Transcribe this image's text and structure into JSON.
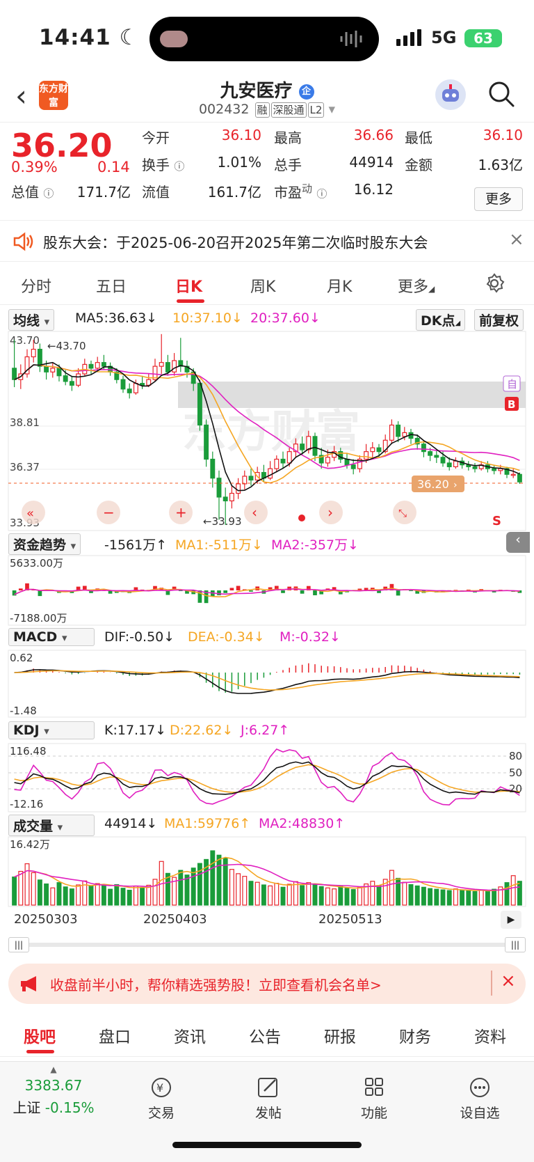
{
  "status_bar": {
    "time": "14:41",
    "network": "5G",
    "battery": "63"
  },
  "header": {
    "logo_text": "东方财富",
    "stock_name": "九安医疗",
    "corp_badge": "企",
    "stock_code": "002432",
    "tags": [
      "融",
      "深股通",
      "L2"
    ]
  },
  "quote": {
    "price": "36.20",
    "change_pct": "0.39%",
    "change": "0.14",
    "open_label": "今开",
    "open": "36.10",
    "high_label": "最高",
    "high": "36.66",
    "low_label": "最低",
    "low": "36.10",
    "turnover_label": "换手",
    "turnover": "1.01%",
    "volume_label": "总手",
    "volume": "44914",
    "amount_label": "金额",
    "amount": "1.63亿",
    "mcap_label": "总值",
    "mcap": "171.7亿",
    "float_label": "流值",
    "float": "161.7亿",
    "pe_label": "市盈",
    "pe_sup": "动",
    "pe": "16.12",
    "more_label": "更多"
  },
  "notice": {
    "text": "股东大会：于2025-06-20召开2025年第二次临时股东大会"
  },
  "tabs": [
    "分时",
    "五日",
    "日K",
    "周K",
    "月K",
    "更多"
  ],
  "kline": {
    "ma_select": "均线",
    "ma5": "MA5:36.63",
    "ma10": "10:37.10",
    "ma20": "20:37.60",
    "dk_btn": "DK点",
    "adj_btn": "前复权",
    "y_labels": [
      "43.70",
      "38.81",
      "36.37",
      "33.93"
    ],
    "high_mark": "43.70",
    "low_mark": "33.93",
    "price_tag": "36.20",
    "markers": {
      "self": "自",
      "buy": "B",
      "sell": "S"
    },
    "watermark": "东方财富",
    "colors": {
      "up": "#e8232a",
      "down": "#1a9c3a",
      "ma5": "#111111",
      "ma10": "#f5a623",
      "ma20": "#e020c0"
    }
  },
  "fund": {
    "select": "资金趋势",
    "value": "-1561万",
    "ma1": "MA1:-511万",
    "ma2": "MA2:-357万",
    "top": "5633.00万",
    "bottom": "-7188.00万"
  },
  "macd": {
    "select": "MACD",
    "dif": "DIF:-0.50",
    "dea": "DEA:-0.34",
    "m": "M:-0.32",
    "top": "0.62",
    "bottom": "-1.48"
  },
  "kdj": {
    "select": "KDJ",
    "k": "K:17.17",
    "d": "D:22.62",
    "j": "J:6.27",
    "top": "116.48",
    "bottom": "-12.16",
    "levels": [
      "80",
      "50",
      "20"
    ]
  },
  "vol": {
    "select": "成交量",
    "value": "44914",
    "ma1": "MA1:59776",
    "ma2": "MA2:48830",
    "top": "16.42万"
  },
  "dates": [
    "20250303",
    "20250403",
    "20250513"
  ],
  "banner": {
    "text": "收盘前半小时，帮你精选强势股！立即查看机会名单>"
  },
  "bottom_tabs": [
    "股吧",
    "盘口",
    "资讯",
    "公告",
    "研报",
    "财务",
    "资料"
  ],
  "dock": {
    "index_value": "3383.67",
    "index_name": "上证",
    "index_change": "-0.15%",
    "items": [
      "交易",
      "发帖",
      "功能",
      "设自选"
    ]
  },
  "chart_data": {
    "type": "candlestick",
    "candles": [
      [
        42.2,
        41.6,
        43.7,
        41.2
      ],
      [
        41.6,
        41.9,
        42.4,
        41.1
      ],
      [
        41.9,
        42.8,
        43.2,
        41.7
      ],
      [
        42.8,
        43.2,
        43.7,
        42.5
      ],
      [
        43.2,
        42.3,
        43.5,
        42.0
      ],
      [
        42.3,
        42.0,
        42.6,
        41.6
      ],
      [
        42.0,
        42.2,
        42.5,
        41.7
      ],
      [
        42.2,
        41.8,
        42.4,
        41.5
      ],
      [
        41.8,
        41.5,
        42.1,
        41.3
      ],
      [
        41.5,
        41.3,
        41.8,
        41.0
      ],
      [
        41.3,
        41.9,
        42.2,
        41.2
      ],
      [
        41.9,
        42.4,
        42.7,
        41.8
      ],
      [
        42.4,
        42.2,
        42.6,
        41.9
      ],
      [
        42.2,
        42.5,
        42.8,
        42.0
      ],
      [
        42.5,
        42.3,
        42.9,
        42.1
      ],
      [
        42.3,
        42.0,
        42.5,
        41.8
      ],
      [
        42.0,
        41.6,
        42.2,
        41.4
      ],
      [
        41.6,
        41.1,
        41.8,
        40.9
      ],
      [
        41.1,
        40.9,
        41.4,
        40.6
      ],
      [
        40.9,
        41.4,
        41.6,
        40.8
      ],
      [
        41.4,
        41.3,
        41.8,
        41.1
      ],
      [
        41.3,
        41.6,
        41.9,
        41.2
      ],
      [
        41.6,
        42.3,
        42.7,
        41.5
      ],
      [
        42.3,
        42.5,
        44.0,
        41.9
      ],
      [
        42.5,
        42.0,
        42.9,
        41.8
      ],
      [
        42.0,
        42.6,
        43.0,
        41.8
      ],
      [
        42.6,
        42.3,
        43.8,
        42.0
      ],
      [
        42.3,
        42.0,
        42.6,
        41.7
      ],
      [
        42.0,
        41.4,
        42.2,
        41.0
      ],
      [
        41.4,
        39.2,
        41.6,
        38.9
      ],
      [
        39.2,
        37.4,
        39.5,
        37.0
      ],
      [
        37.4,
        36.4,
        37.8,
        35.9
      ],
      [
        36.4,
        35.4,
        36.8,
        34.2
      ],
      [
        35.4,
        35.2,
        35.9,
        33.93
      ],
      [
        35.2,
        35.6,
        36.0,
        34.8
      ],
      [
        35.6,
        36.1,
        36.4,
        35.3
      ],
      [
        36.1,
        36.5,
        36.8,
        35.8
      ],
      [
        36.5,
        36.3,
        36.9,
        36.0
      ],
      [
        36.3,
        36.7,
        37.0,
        36.1
      ],
      [
        36.7,
        36.4,
        37.1,
        36.2
      ],
      [
        36.4,
        36.9,
        37.3,
        36.3
      ],
      [
        36.9,
        37.4,
        37.6,
        36.7
      ],
      [
        37.4,
        37.2,
        37.8,
        36.9
      ],
      [
        37.2,
        37.8,
        38.0,
        37.0
      ],
      [
        37.8,
        38.2,
        38.5,
        37.5
      ],
      [
        38.2,
        37.9,
        38.6,
        37.6
      ],
      [
        37.9,
        38.6,
        38.9,
        37.7
      ],
      [
        38.6,
        37.6,
        38.8,
        37.3
      ],
      [
        37.6,
        37.2,
        38.0,
        36.9
      ],
      [
        37.2,
        37.5,
        37.9,
        37.0
      ],
      [
        37.5,
        37.8,
        38.1,
        37.3
      ],
      [
        37.8,
        37.4,
        38.0,
        37.2
      ],
      [
        37.4,
        37.1,
        37.7,
        36.9
      ],
      [
        37.1,
        36.9,
        37.4,
        36.6
      ],
      [
        36.9,
        37.4,
        37.6,
        36.7
      ],
      [
        37.4,
        37.8,
        38.2,
        37.2
      ],
      [
        37.8,
        38.0,
        38.3,
        37.5
      ],
      [
        38.0,
        37.8,
        38.2,
        37.5
      ],
      [
        37.8,
        38.4,
        38.7,
        37.7
      ],
      [
        38.4,
        39.2,
        39.5,
        38.2
      ],
      [
        39.2,
        38.6,
        39.4,
        38.3
      ],
      [
        38.6,
        38.8,
        39.1,
        38.4
      ],
      [
        38.8,
        38.5,
        39.0,
        38.2
      ],
      [
        38.5,
        38.2,
        38.7,
        37.9
      ],
      [
        38.2,
        37.8,
        38.4,
        37.5
      ],
      [
        37.8,
        37.6,
        38.0,
        37.3
      ],
      [
        37.6,
        37.5,
        37.9,
        37.2
      ],
      [
        37.5,
        37.2,
        37.8,
        37.0
      ],
      [
        37.2,
        37.0,
        37.5,
        36.8
      ],
      [
        37.0,
        37.3,
        37.5,
        36.9
      ],
      [
        37.3,
        37.1,
        37.5,
        36.9
      ],
      [
        37.1,
        37.0,
        37.3,
        36.8
      ],
      [
        37.0,
        36.9,
        37.2,
        36.7
      ],
      [
        36.9,
        37.1,
        37.3,
        36.8
      ],
      [
        37.1,
        36.9,
        37.3,
        36.7
      ],
      [
        36.9,
        36.8,
        37.1,
        36.6
      ],
      [
        36.8,
        36.9,
        37.1,
        36.6
      ],
      [
        36.9,
        36.6,
        37.0,
        36.4
      ],
      [
        36.6,
        36.6,
        36.9,
        36.4
      ],
      [
        36.6,
        36.2,
        36.7,
        36.1
      ]
    ],
    "volume_wan": [
      8.5,
      10.2,
      12.5,
      9.8,
      7.6,
      6.4,
      5.2,
      6.8,
      5.5,
      4.9,
      6.1,
      7.3,
      5.8,
      6.5,
      5.9,
      4.8,
      6.2,
      5.1,
      4.5,
      5.7,
      5.3,
      6.0,
      7.8,
      13.2,
      9.6,
      8.4,
      10.5,
      9.1,
      11.2,
      12.6,
      13.8,
      16.42,
      15.1,
      14.2,
      10.8,
      9.5,
      8.7,
      7.2,
      6.9,
      6.1,
      5.8,
      6.6,
      5.4,
      6.3,
      7.1,
      5.9,
      6.8,
      6.2,
      5.6,
      5.2,
      4.9,
      5.8,
      5.1,
      4.7,
      5.5,
      6.4,
      7.2,
      5.9,
      7.8,
      10.5,
      8.1,
      6.9,
      6.2,
      5.8,
      5.4,
      5.0,
      4.8,
      4.6,
      4.4,
      4.9,
      4.5,
      4.3,
      4.1,
      4.6,
      4.2,
      4.8,
      5.5,
      6.8,
      8.9,
      7.2
    ],
    "ylim": [
      33.93,
      43.7
    ],
    "x_ticks": [
      "20250303",
      "20250403",
      "20250513"
    ]
  }
}
